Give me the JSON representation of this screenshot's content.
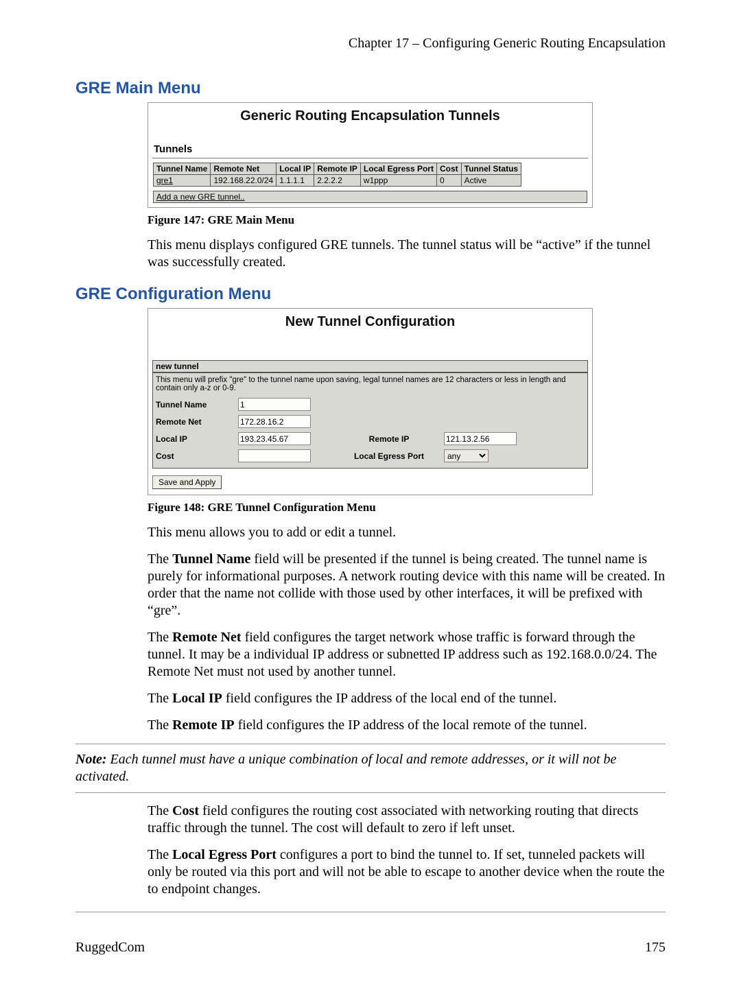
{
  "chapter_header": "Chapter 17 – Configuring Generic Routing Encapsulation",
  "section1_title": "GRE Main Menu",
  "fig1": {
    "panel_title": "Generic Routing Encapsulation Tunnels",
    "subhead": "Tunnels",
    "cols": [
      "Tunnel Name",
      "Remote Net",
      "Local IP",
      "Remote IP",
      "Local Egress Port",
      "Cost",
      "Tunnel Status"
    ],
    "row": {
      "name": "gre1",
      "remote_net": "192.168.22.0/24",
      "local_ip": "1.1.1.1",
      "remote_ip": "2.2.2.2",
      "egress": "w1ppp",
      "cost": "0",
      "status": "Active"
    },
    "add_label": "Add a new GRE tunnel..",
    "caption": "Figure 147: GRE Main Menu"
  },
  "para1": "This menu displays configured GRE tunnels.  The tunnel status will be “active” if the tunnel was successfully created.",
  "section2_title": "GRE Configuration Menu",
  "fig2": {
    "panel_title": "New Tunnel Configuration",
    "row_title": "new tunnel",
    "msg": "This menu will prefix \"gre\" to the tunnel name upon saving, legal tunnel names are 12 characters or less in length and contain only a-z or 0-9.",
    "labels": {
      "tunnel_name": "Tunnel Name",
      "remote_net": "Remote Net",
      "local_ip": "Local IP",
      "remote_ip": "Remote IP",
      "cost": "Cost",
      "egress": "Local Egress Port"
    },
    "values": {
      "tunnel_name": "1",
      "remote_net": "172.28.16.2",
      "local_ip": "193.23.45.67",
      "remote_ip": "121.13.2.56",
      "cost": "",
      "egress": "any"
    },
    "button": "Save and Apply",
    "caption": "Figure 148:  GRE Tunnel Configuration Menu"
  },
  "para2": "This menu allows you to add or edit a tunnel.",
  "para3_pre": "The ",
  "para3_b": "Tunnel Name",
  "para3_post": " field will be presented if the tunnel is being created.  The tunnel name is purely for informational purposes.  A network routing device with this name will be created.  In order that the name not collide with those used by other interfaces, it will be prefixed with “gre”.",
  "para4_pre": "The ",
  "para4_b": "Remote Net",
  "para4_post": " field configures the target network whose traffic is forward through the tunnel.  It may be a individual IP address or subnetted IP address such as 192.168.0.0/24.  The Remote Net must not used by another tunnel.",
  "para5_pre": "The ",
  "para5_b": "Local IP",
  "para5_post": " field configures the IP address of the local end of the tunnel.",
  "para6_pre": "The ",
  "para6_b": "Remote IP",
  "para6_post": " field configures the IP address of the local remote of the tunnel.",
  "note_b": "Note:",
  "note_body": "  Each tunnel must have a unique combination of local and remote addresses, or it will not be activated.",
  "para7_pre": "The ",
  "para7_b": "Cost",
  "para7_post": " field configures the routing cost associated with networking routing that directs traffic through the tunnel.  The cost will default to zero if left unset.",
  "para8_pre": "The ",
  "para8_b": "Local Egress Port",
  "para8_post": " configures a port to bind  the tunnel to.  If set, tunneled packets will only be routed via this port and will not be able to escape to another device when the route the to endpoint changes.",
  "footer_left": "RuggedCom",
  "footer_right": "175"
}
